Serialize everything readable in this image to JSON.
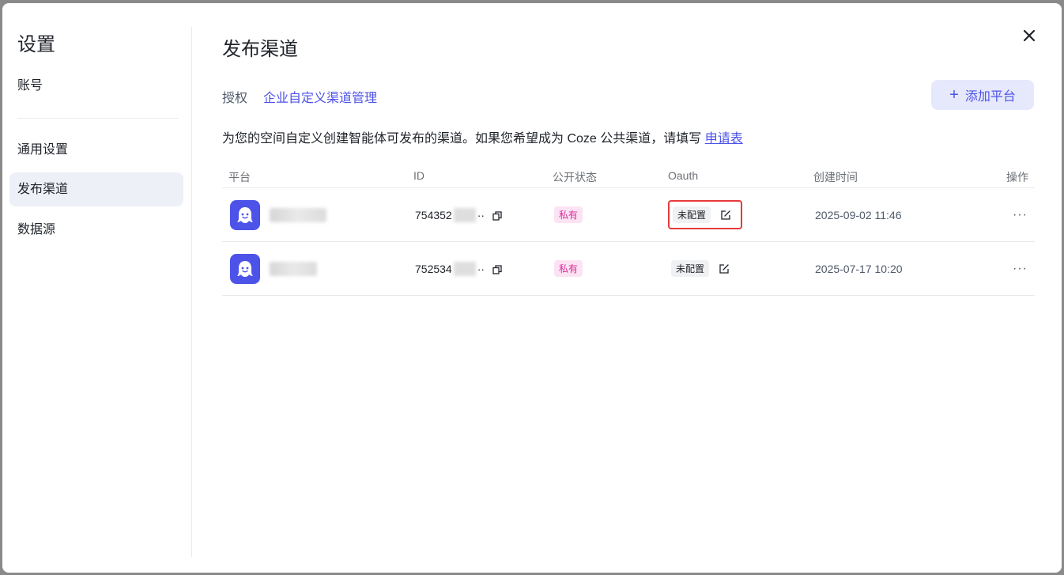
{
  "sidebar": {
    "title": "设置",
    "items": [
      {
        "label": "账号"
      },
      {
        "label": "通用设置"
      },
      {
        "label": "发布渠道"
      },
      {
        "label": "数据源"
      }
    ]
  },
  "main": {
    "title": "发布渠道",
    "tabs": [
      {
        "label": "授权"
      },
      {
        "label": "企业自定义渠道管理"
      }
    ],
    "add_button": "添加平台",
    "description": "为您的空间自定义创建智能体可发布的渠道。如果您希望成为 Coze 公共渠道，请填写 ",
    "description_link": "申请表"
  },
  "table": {
    "headers": [
      "平台",
      "ID",
      "公开状态",
      "Oauth",
      "创建时间",
      "操作"
    ],
    "rows": [
      {
        "id_prefix": "754352",
        "id_suffix": "··",
        "status": "私有",
        "oauth": "未配置",
        "created": "2025-09-02 11:46",
        "actions": "···"
      },
      {
        "id_prefix": "752534",
        "id_suffix": "··",
        "status": "私有",
        "oauth": "未配置",
        "created": "2025-07-17 10:20",
        "actions": "···"
      }
    ]
  },
  "colors": {
    "accent": "#4d53e8",
    "private_tag": "#d92d9b",
    "highlight": "#e63b3b"
  }
}
